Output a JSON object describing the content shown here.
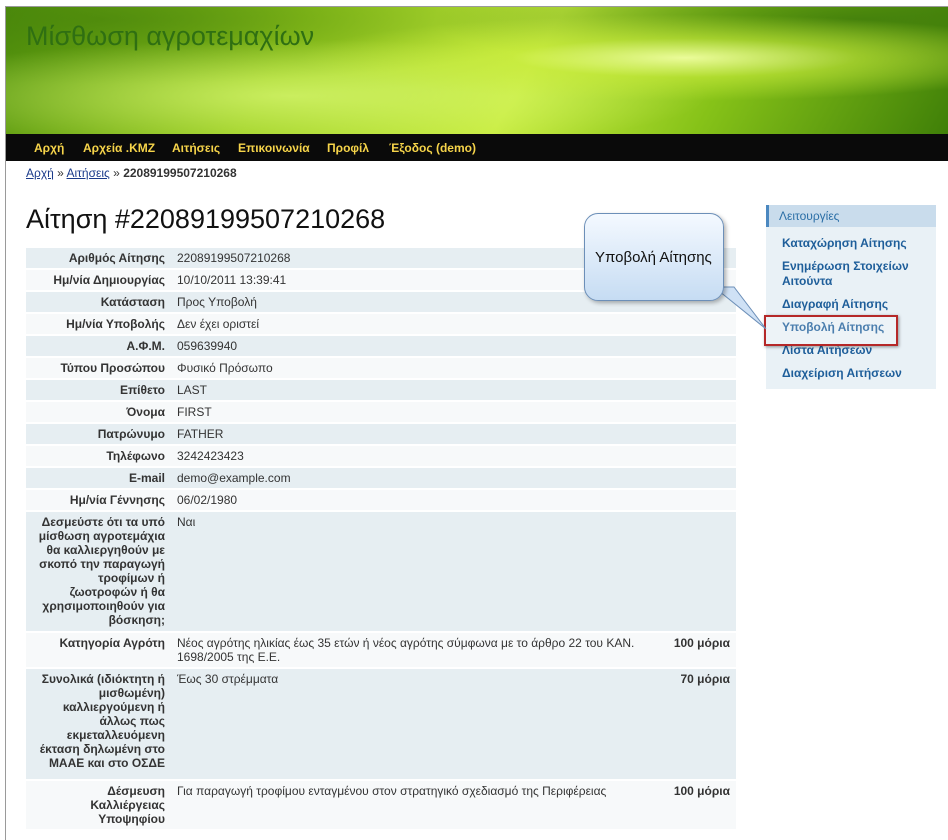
{
  "site_title": "Μίσθωση αγροτεμαχίων",
  "nav": [
    "Αρχή",
    "Αρχεία .KMZ",
    "Αιτήσεις",
    "Επικοινωνία",
    "Προφίλ",
    "Έξοδος (demo)"
  ],
  "breadcrumb": {
    "home": "Αρχή",
    "sep1": "»",
    "section": "Αιτήσεις",
    "sep2": "»",
    "current": "22089199507210268"
  },
  "page_title": "Αίτηση #22089199507210268",
  "fields": [
    {
      "label": "Αριθμός Αίτησης",
      "value": "22089199507210268"
    },
    {
      "label": "Ημ/νία Δημιουργίας",
      "value": "10/10/2011 13:39:41"
    },
    {
      "label": "Κατάσταση",
      "value": "Προς Υποβολή"
    },
    {
      "label": "Ημ/νία Υποβολής",
      "value": "Δεν έχει οριστεί"
    },
    {
      "label": "Α.Φ.Μ.",
      "value": "059639940"
    },
    {
      "label": "Τύπου Προσώπου",
      "value": "Φυσικό Πρόσωπο"
    },
    {
      "label": "Επίθετο",
      "value": "LAST"
    },
    {
      "label": "Όνομα",
      "value": "FIRST"
    },
    {
      "label": "Πατρώνυμο",
      "value": "FATHER"
    },
    {
      "label": "Τηλέφωνο",
      "value": "3242423423"
    },
    {
      "label": "E-mail",
      "value": "demo@example.com"
    },
    {
      "label": "Ημ/νία Γέννησης",
      "value": "06/02/1980"
    },
    {
      "label": "Δεσμεύστε ότι τα υπό μίσθωση αγροτεμάχια θα καλλιεργηθούν με σκοπό την παραγωγή τροφίμων ή ζωοτροφών ή θα χρησιμοποιηθούν για βόσκηση;",
      "value": "Ναι"
    },
    {
      "label": "Κατηγορία Αγρότη",
      "value": "Νέος αγρότης ηλικίας έως 35 ετών ή νέος αγρότης σύμφωνα με το άρθρο 22 του ΚΑΝ. 1698/2005 της Ε.Ε.",
      "points": "100 μόρια"
    },
    {
      "label": "Συνολικά (ιδιόκτητη ή μισθωμένη) καλλιεργούμενη ή άλλως πως εκμεταλλευόμενη έκταση δηλωμένη στο ΜΑΑΕ και στο ΟΣΔΕ",
      "value": "Έως 30 στρέμματα",
      "points": "70 μόρια"
    },
    {
      "label": "Δέσμευση Καλλιέργειας Υποψηφίου",
      "value": "Για παραγωγή τροφίμου ενταγμένου στον στρατηγικό σχεδιασμό της Περιφέρειας",
      "points": "100 μόρια"
    }
  ],
  "sidebar": {
    "heading": "Λειτουργίες",
    "links": [
      "Καταχώρηση Αίτησης",
      "Ενημέρωση Στοιχείων Αιτούντα",
      "Διαγραφή Αίτησης",
      "Υποβολή Αίτησης",
      "Λίστα Αιτήσεων",
      "Διαχείριση Αιτήσεων"
    ]
  },
  "callout_text": "Υποβολή Αίτησης",
  "colors": {
    "nav_bg": "#0a0a0a",
    "nav_text": "#f6d44a",
    "link": "#1e5e9a",
    "highlight": "#b52828"
  }
}
